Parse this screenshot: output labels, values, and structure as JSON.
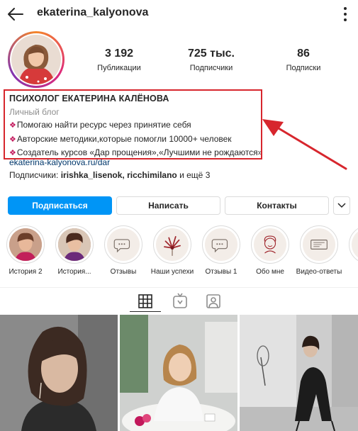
{
  "header": {
    "username": "ekaterina_kalyonova",
    "back_icon": "arrow-left-icon",
    "more_icon": "vertical-dots-icon"
  },
  "stats": {
    "posts": {
      "value": "3 192",
      "label": "Публикации"
    },
    "followers": {
      "value": "725 тыс.",
      "label": "Подписчики"
    },
    "following": {
      "value": "86",
      "label": "Подписки"
    }
  },
  "bio": {
    "name": "ПСИХОЛОГ ЕКАТЕРИНА КАЛЁНОВА",
    "category": "Личный блог",
    "gem": "❖",
    "lines": [
      "Помогаю найти ресурс через принятие себя",
      "Авторские методики,которые помогли 10000+ человек",
      "Создатель курсов «Дар прощения»,«Лучшими не рождаются»"
    ],
    "link": "ekaterina-kalyonova.ru/dar",
    "followed_by_prefix": "Подписчики: ",
    "followed_by_names": "irishka_lisenok, ricchimilano",
    "followed_by_suffix": " и ещё 3"
  },
  "colors": {
    "accent": "#0095f6",
    "highlight_box": "#d7262d",
    "link": "#00376b"
  },
  "buttons": {
    "follow": "Подписаться",
    "message": "Написать",
    "contacts": "Контакты",
    "more_icon": "chevron-down-icon"
  },
  "stories": [
    {
      "label": "История 2"
    },
    {
      "label": "История..."
    },
    {
      "label": "Отзывы"
    },
    {
      "label": "Наши успехи"
    },
    {
      "label": "Отзывы 1"
    },
    {
      "label": "Обо мне"
    },
    {
      "label": "Видео-ответы"
    }
  ],
  "tabs": [
    {
      "icon": "grid-icon",
      "active": true
    },
    {
      "icon": "igtv-icon",
      "active": false
    },
    {
      "icon": "tagged-icon",
      "active": false
    }
  ]
}
